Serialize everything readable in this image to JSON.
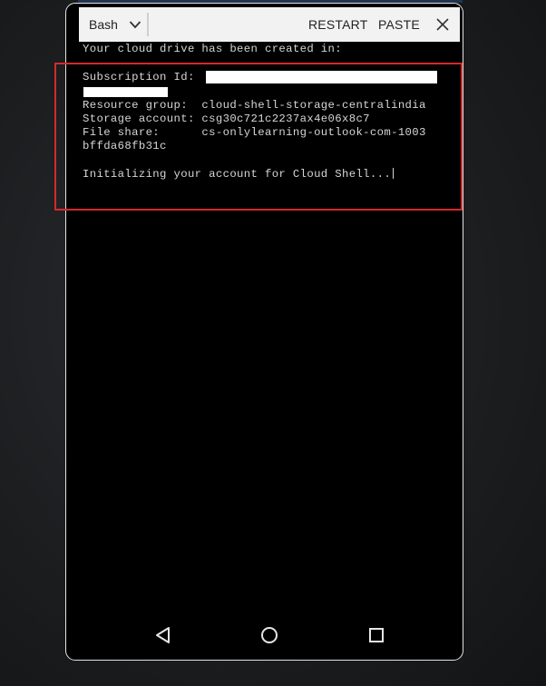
{
  "toolbar": {
    "shell_label": "Bash",
    "restart_label": "RESTART",
    "paste_label": "PASTE"
  },
  "terminal": {
    "line_created": "Your cloud drive has been created in:",
    "subscription_label": "Subscription Id:",
    "resource_group": "Resource group:  cloud-shell-storage-centralindia",
    "storage_account": "Storage account: csg30c721c2237ax4e06x8c7",
    "file_share_1": "File share:      cs-onlylearning-outlook-com-1003",
    "file_share_2": "bffda68fb31c",
    "initializing": "Initializing your account for Cloud Shell..."
  },
  "icons": {
    "shell_dropdown": "chevron-down-icon",
    "close": "close-icon",
    "nav_back": "triangle-back-icon",
    "nav_home": "circle-home-icon",
    "nav_recent": "square-recent-icon"
  },
  "colors": {
    "terminal_bg": "#000000",
    "terminal_text": "#d6d6d6",
    "toolbar_bg": "#f2f2f2",
    "highlight": "#d42a2a"
  }
}
